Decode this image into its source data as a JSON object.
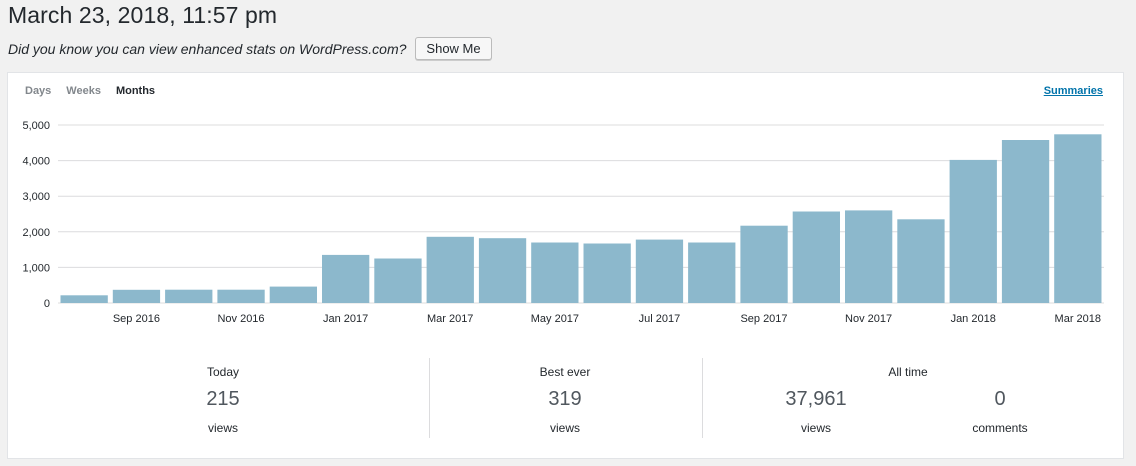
{
  "header": {
    "date": "March 23, 2018, 11:57 pm",
    "promo_text": "Did you know you can view enhanced stats on WordPress.com?",
    "show_me_label": "Show Me"
  },
  "panel": {
    "tabs": [
      {
        "label": "Days",
        "active": false
      },
      {
        "label": "Weeks",
        "active": false
      },
      {
        "label": "Months",
        "active": true
      }
    ],
    "summaries_label": "Summaries"
  },
  "colors": {
    "bar": "#8cb8cc",
    "grid": "#dcdcde",
    "link": "#0073aa"
  },
  "chart_data": {
    "type": "bar",
    "categories": [
      "Aug 2016",
      "Sep 2016",
      "Oct 2016",
      "Nov 2016",
      "Dec 2016",
      "Jan 2017",
      "Feb 2017",
      "Mar 2017",
      "Apr 2017",
      "May 2017",
      "Jun 2017",
      "Jul 2017",
      "Aug 2017",
      "Sep 2017",
      "Oct 2017",
      "Nov 2017",
      "Dec 2017",
      "Jan 2018",
      "Feb 2018",
      "Mar 2018"
    ],
    "values": [
      215,
      370,
      375,
      375,
      460,
      1350,
      1250,
      1860,
      1820,
      1700,
      1670,
      1780,
      1700,
      2170,
      2570,
      2600,
      2350,
      4020,
      4580,
      4740
    ],
    "x_tick_labels": [
      "Sep 2016",
      "Nov 2016",
      "Jan 2017",
      "Mar 2017",
      "May 2017",
      "Jul 2017",
      "Sep 2017",
      "Nov 2017",
      "Jan 2018",
      "Mar 2018"
    ],
    "y_ticks": [
      "0",
      "1,000",
      "2,000",
      "3,000",
      "4,000",
      "5,000"
    ],
    "ylim": [
      0,
      5000
    ],
    "grid": true
  },
  "summary": {
    "today": {
      "label": "Today",
      "value": "215",
      "unit": "views"
    },
    "best_ever": {
      "label": "Best ever",
      "value": "319",
      "unit": "views"
    },
    "all_time": {
      "label": "All time",
      "views": {
        "value": "37,961",
        "unit": "views"
      },
      "comments": {
        "value": "0",
        "unit": "comments"
      }
    }
  }
}
